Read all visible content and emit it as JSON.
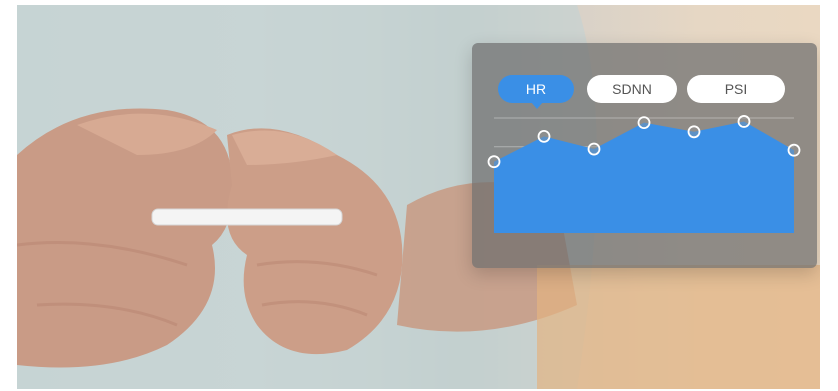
{
  "tabs": [
    {
      "label": "HR",
      "active": true
    },
    {
      "label": "SDNN",
      "active": false
    },
    {
      "label": "PSI",
      "active": false
    }
  ],
  "colors": {
    "accent": "#3a8fe6",
    "panel": "#6e6e6e",
    "tab_inactive": "#ffffff"
  },
  "chart_data": {
    "type": "area",
    "series": [
      {
        "values": [
          0.62,
          0.84,
          0.73,
          0.96,
          0.88,
          0.97,
          0.72
        ]
      }
    ],
    "ylim": [
      0,
      1
    ],
    "grid": true
  }
}
